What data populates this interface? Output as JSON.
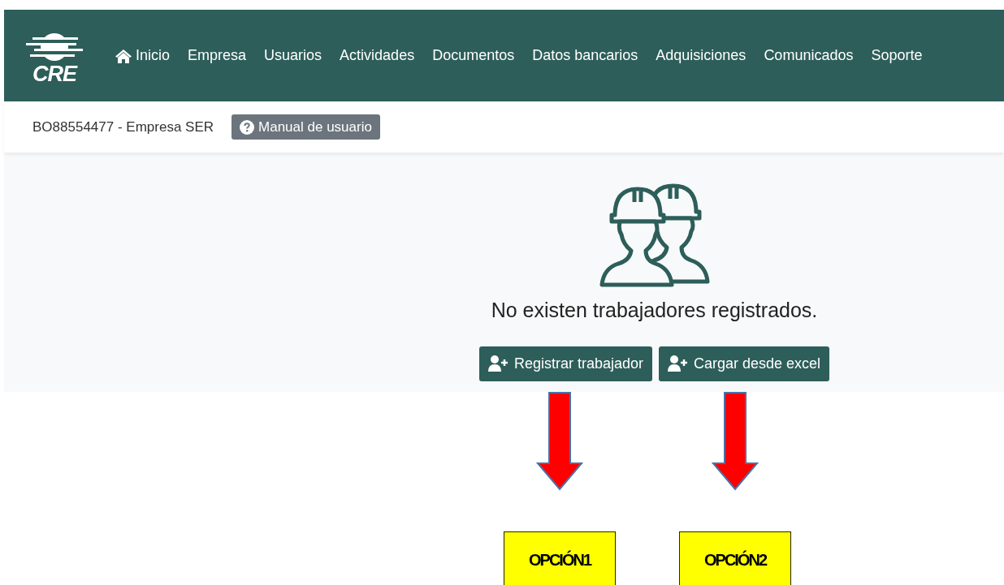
{
  "logo": {
    "text": "CRE"
  },
  "nav": [
    {
      "label": "Inicio",
      "kind": "home"
    },
    {
      "label": "Empresa"
    },
    {
      "label": "Usuarios"
    },
    {
      "label": "Actividades"
    },
    {
      "label": "Documentos"
    },
    {
      "label": "Datos bancarios"
    },
    {
      "label": "Adquisiciones"
    },
    {
      "label": "Comunicados"
    },
    {
      "label": "Soporte"
    }
  ],
  "company": "BO88554477 - Empresa SER",
  "manual_button": "Manual de usuario",
  "empty_message": "No existen trabajadores registrados.",
  "actions": [
    {
      "label": "Registrar trabajador"
    },
    {
      "label": "Cargar desde excel"
    }
  ],
  "annotations": [
    {
      "label": "OPCIÓN1"
    },
    {
      "label": "OPCIÓN2"
    }
  ]
}
